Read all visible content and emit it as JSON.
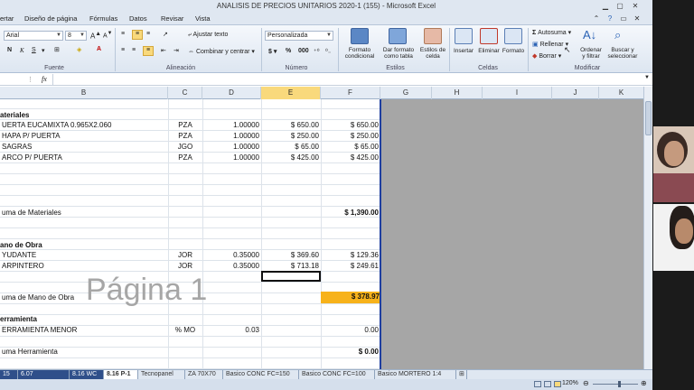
{
  "window": {
    "title": "ANALISIS DE PRECIOS UNITARIOS 2020-1 (155) - Microsoft Excel"
  },
  "menu": [
    "ertar",
    "Diseño de página",
    "Fórmulas",
    "Datos",
    "Revisar",
    "Vista"
  ],
  "ribbon": {
    "font_name": "Arial",
    "font_size": "8",
    "number_format": "Personalizada",
    "wrap_text": "Ajustar texto",
    "merge_center": "Combinar y centrar",
    "groups": {
      "fuente": "Fuente",
      "alineacion": "Alineación",
      "numero": "Número",
      "estilos": "Estilos",
      "celdas": "Celdas",
      "modificar": "Modificar"
    },
    "estilos_btns": [
      {
        "l1": "Formato",
        "l2": "condicional"
      },
      {
        "l1": "Dar formato",
        "l2": "como tabla"
      },
      {
        "l1": "Estilos de",
        "l2": "celda"
      }
    ],
    "celdas_btns": [
      "Insertar",
      "Eliminar",
      "Formato"
    ],
    "modificar": {
      "autosuma": "Autosuma",
      "rellenar": "Rellenar",
      "borrar": "Borrar",
      "ordenar_l1": "Ordenar",
      "ordenar_l2": "y filtrar",
      "buscar_l1": "Buscar y",
      "buscar_l2": "seleccionar"
    },
    "colors": {
      "accent": "#f9d97c",
      "total_fill": "#f7b21a"
    }
  },
  "formula_bar": {
    "fx": "fx"
  },
  "columns": [
    "B",
    "C",
    "D",
    "E",
    "F",
    "G",
    "H",
    "I",
    "J",
    "K"
  ],
  "rows": {
    "mat_header": "ateriales",
    "mat1": {
      "desc": "UERTA EUCAMIXTA 0.965X2.060",
      "unit": "PZA",
      "qty": "1.00000",
      "price": "$ 650.00",
      "total": "$ 650.00"
    },
    "mat2": {
      "desc": "HAPA P/ PUERTA",
      "unit": "PZA",
      "qty": "1.00000",
      "price": "$ 250.00",
      "total": "$ 250.00"
    },
    "mat3": {
      "desc": "SAGRAS",
      "unit": "JGO",
      "qty": "1.00000",
      "price": "$ 65.00",
      "total": "$ 65.00"
    },
    "mat4": {
      "desc": "ARCO P/ PUERTA",
      "unit": "PZA",
      "qty": "1.00000",
      "price": "$ 425.00",
      "total": "$ 425.00"
    },
    "mat_sum": {
      "label": "uma de Materiales",
      "total": "$ 1,390.00"
    },
    "mo_header": "ano de Obra",
    "mo1": {
      "desc": "YUDANTE",
      "unit": "JOR",
      "qty": "0.35000",
      "price": "$ 369.60",
      "total": "$ 129.36"
    },
    "mo2": {
      "desc": "ARPINTERO",
      "unit": "JOR",
      "qty": "0.35000",
      "price": "$ 713.18",
      "total": "$ 249.61"
    },
    "mo_sum": {
      "label": "uma de Mano de Obra",
      "total": "$ 378.97"
    },
    "her_header": "erramienta",
    "her1": {
      "desc": "ERRAMIENTA MENOR",
      "unit": "% MO",
      "qty": "0.03",
      "total": "0.00"
    },
    "her_sum": {
      "label": "uma Herramienta",
      "total": "$ 0.00"
    }
  },
  "watermark": "Página 1",
  "sheet_tabs": [
    "15",
    "6.07 IMPERMEAB",
    "8.16 WC",
    "8.16 P-1",
    "Tecnopanel",
    "ZA 70X70",
    "Basico CONC FC=150",
    "Basico CONC FC=100",
    "Basico MORTERO 1:4"
  ],
  "active_tab": "8.16 P-1",
  "status": {
    "zoom": "120%"
  }
}
